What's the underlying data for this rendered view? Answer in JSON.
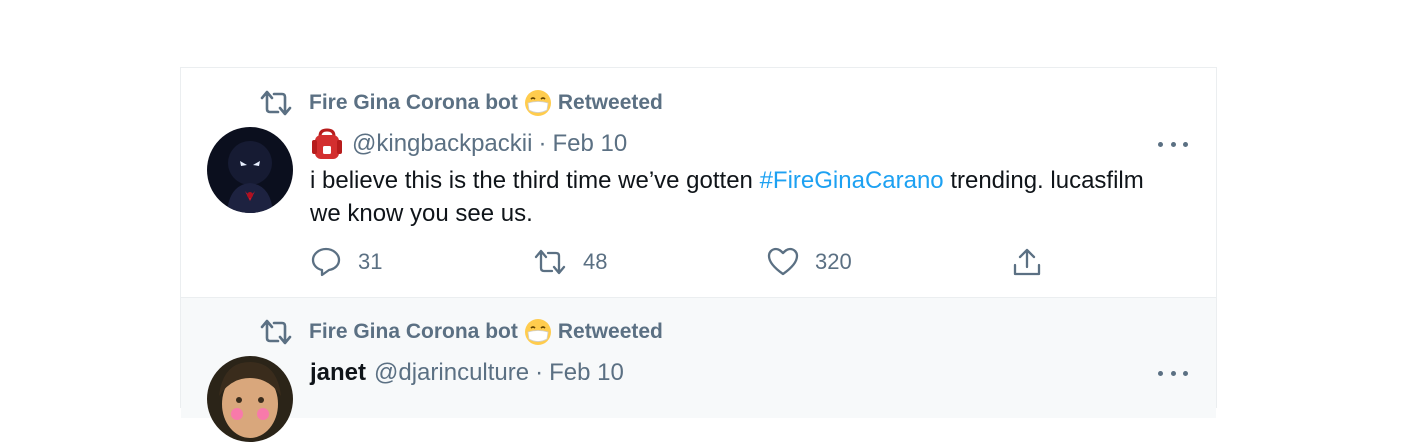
{
  "tweets": [
    {
      "retweeted_by": "Fire Gina Corona bot",
      "retweeted_label": "Retweeted",
      "display_name": "",
      "handle": "@kingbackpackii",
      "separator": "·",
      "date": "Feb 10",
      "text_part1": "i believe this is the third time we’ve gotten ",
      "hashtag": "#FireGinaCarano",
      "text_part2": " trending. lucasfilm we know you see us.",
      "actions": {
        "reply_count": "31",
        "retweet_count": "48",
        "like_count": "320"
      }
    },
    {
      "retweeted_by": "Fire Gina Corona bot",
      "retweeted_label": "Retweeted",
      "display_name": "janet",
      "handle": "@djarinculture",
      "separator": "·",
      "date": "Feb 10"
    }
  ],
  "colors": {
    "secondary_text": "#5b7083",
    "link": "#1da1f2",
    "primary_text": "#0f1419",
    "border": "#ebeef0"
  },
  "icons": {
    "retweet": "retweet-icon",
    "emoji": "face-with-medical-mask-emoji",
    "badge": "red-backpack-emoji",
    "reply": "reply-icon",
    "like": "heart-icon",
    "share": "share-icon",
    "more": "more-options-icon"
  }
}
